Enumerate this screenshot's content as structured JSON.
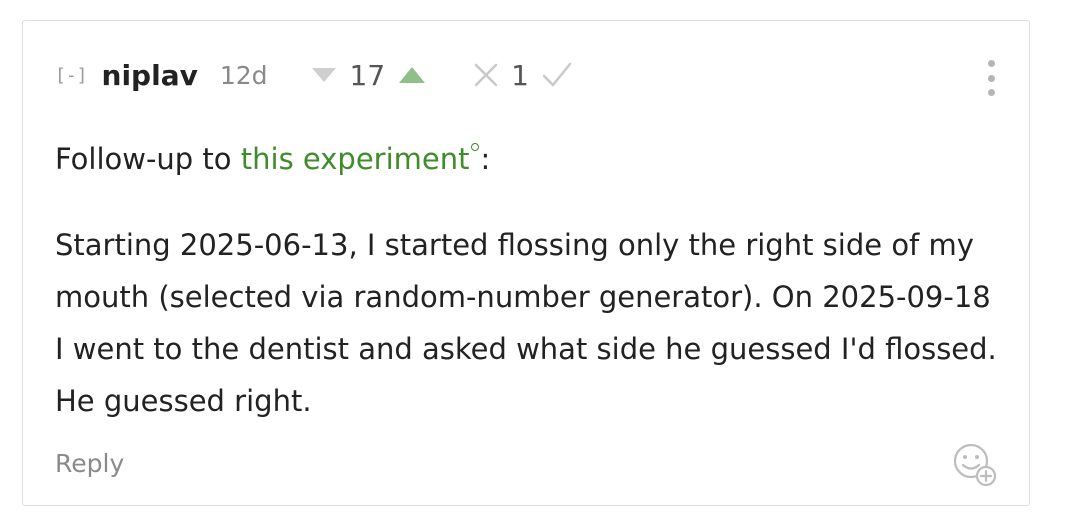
{
  "comment": {
    "collapse_toggle": "[-]",
    "author": "niplav",
    "age": "12d",
    "karma": {
      "score": "17",
      "downvote_icon": "triangle-down-icon",
      "upvote_icon": "triangle-up-icon",
      "upvote_color": "#8fc08a",
      "downvote_color": "#cfcfcf"
    },
    "agreement": {
      "score": "1",
      "disagree_icon": "cross-icon",
      "agree_icon": "check-icon"
    },
    "menu_icon": "vertical-dots-icon",
    "body": {
      "intro_prefix": "Follow-up to ",
      "link_text": "this experiment",
      "intro_suffix": ":",
      "paragraph": "Starting 2025-06-13, I started flossing only the right side of my mouth (selected via random-number generator). On 2025-09-18 I went to the dentist and asked what side he guessed I'd flossed. He guessed right."
    },
    "reply_label": "Reply",
    "react_icon": "add-reaction-icon",
    "link_color": "#3f8c2a"
  }
}
